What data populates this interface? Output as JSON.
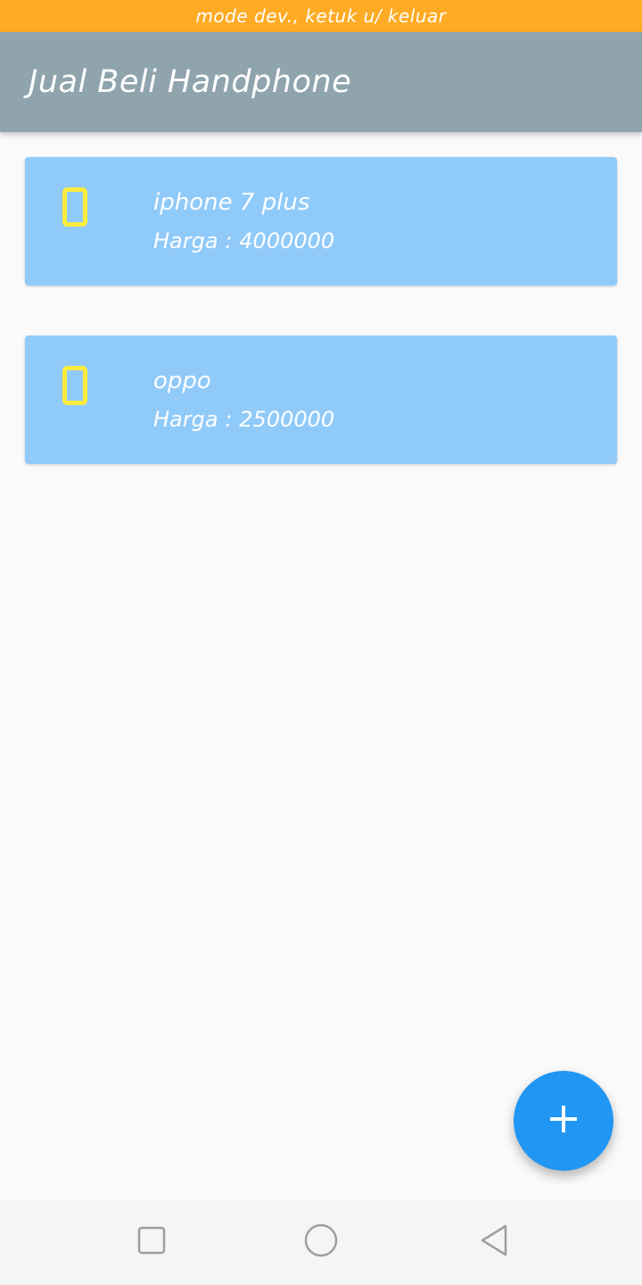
{
  "dev_banner": {
    "text": "mode dev., ketuk u/ keluar"
  },
  "app_bar": {
    "title": "Jual Beli Handphone"
  },
  "items": [
    {
      "name": "iphone 7 plus",
      "price_label": "Harga :",
      "price": "4000000",
      "icon": "smartphone-icon"
    },
    {
      "name": "oppo",
      "price_label": "Harga :",
      "price": "2500000",
      "icon": "smartphone-icon"
    }
  ],
  "fab": {
    "icon": "plus-icon"
  },
  "nav_bar": {
    "icons": [
      "recent-apps-icon",
      "home-icon",
      "back-icon"
    ]
  },
  "colors": {
    "banner": "#ffab24",
    "app_bar": "#90a4ae",
    "card": "#90caf9",
    "phone_icon": "#ffeb3b",
    "fab": "#2196f3"
  }
}
